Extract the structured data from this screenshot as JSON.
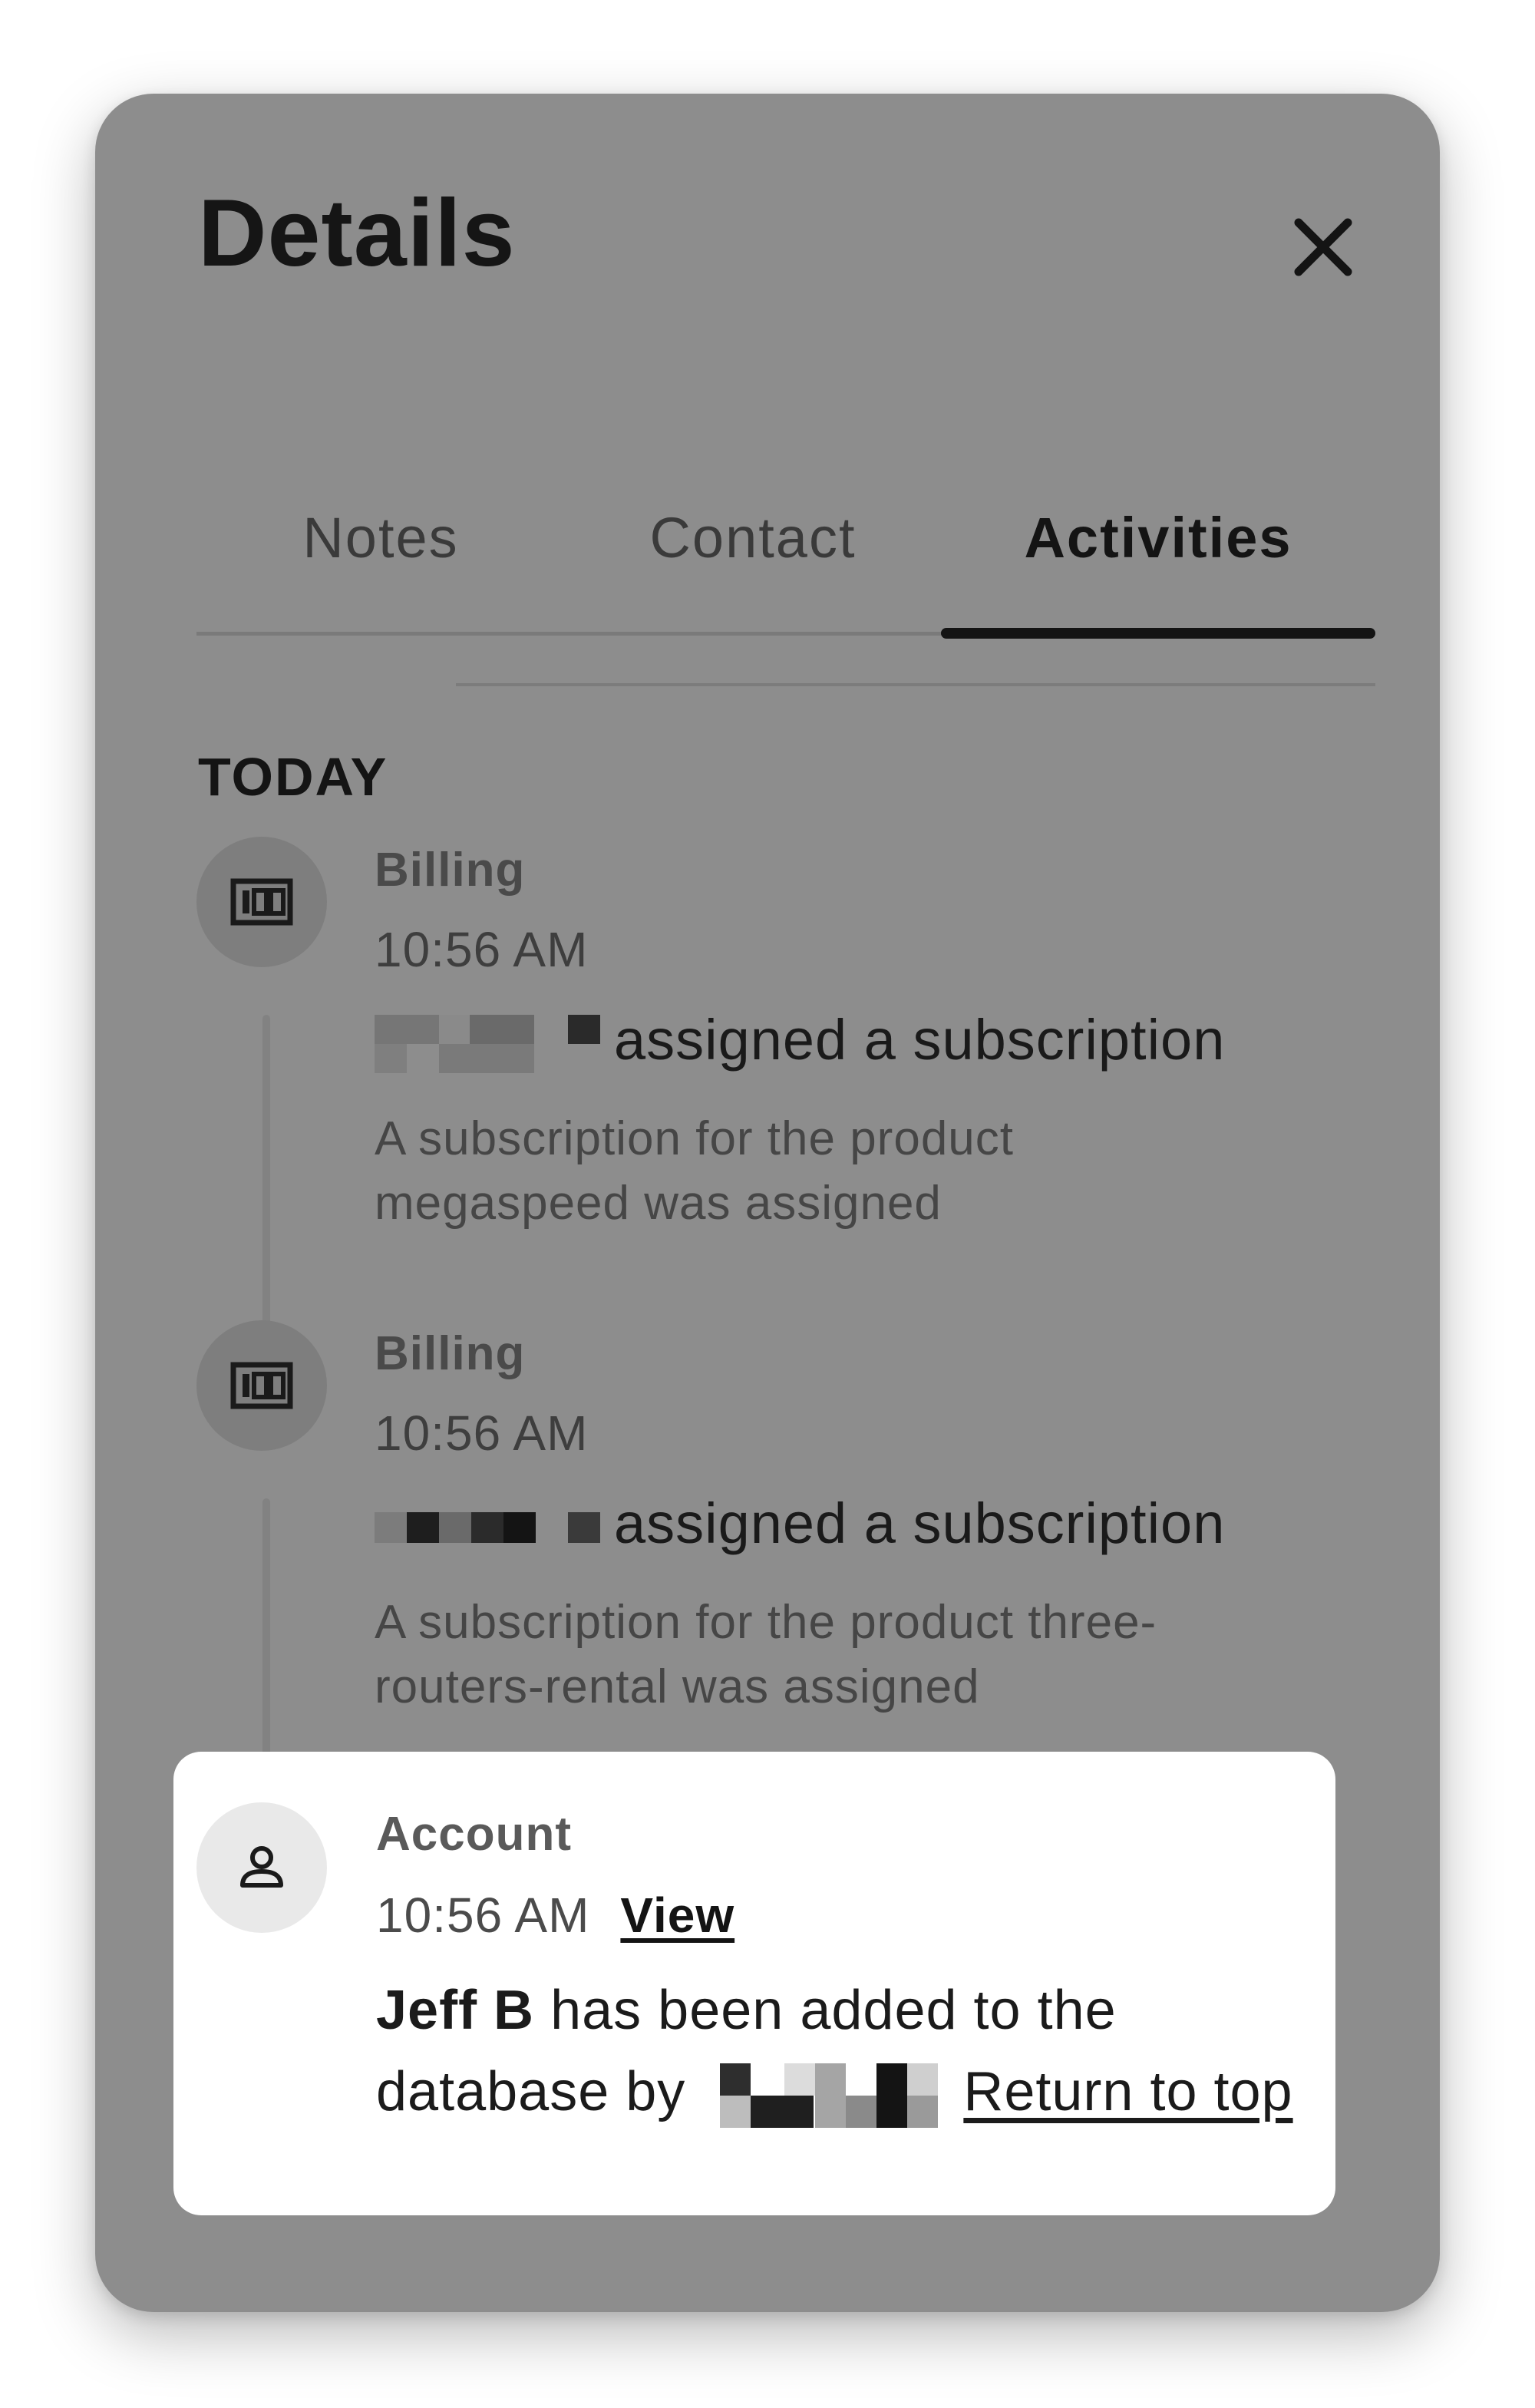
{
  "panel": {
    "title": "Details"
  },
  "tabs": [
    {
      "label": "Notes",
      "active": false
    },
    {
      "label": "Contact",
      "active": false
    },
    {
      "label": "Activities",
      "active": true
    }
  ],
  "section": {
    "label": "TODAY"
  },
  "activities": [
    {
      "icon": "billing-icon",
      "category": "Billing",
      "time": "10:56 AM",
      "title_suffix": "assigned a subscription",
      "description": "A subscription for the product megaspeed was assigned"
    },
    {
      "icon": "billing-icon",
      "category": "Billing",
      "time": "10:56 AM",
      "title_suffix": "assigned a subscription",
      "description": "A subscription for the product three-routers-rental was assigned"
    },
    {
      "icon": "user-icon",
      "category": "Account",
      "time": "10:56 AM",
      "view_label": "View",
      "title_name": "Jeff B",
      "title_text": "has been added to the database by",
      "return_label": "Return to top"
    }
  ],
  "colors": {
    "panel_background": "#8d8d8d",
    "highlight_background": "#ffffff",
    "active_tab_indicator": "#141414"
  }
}
